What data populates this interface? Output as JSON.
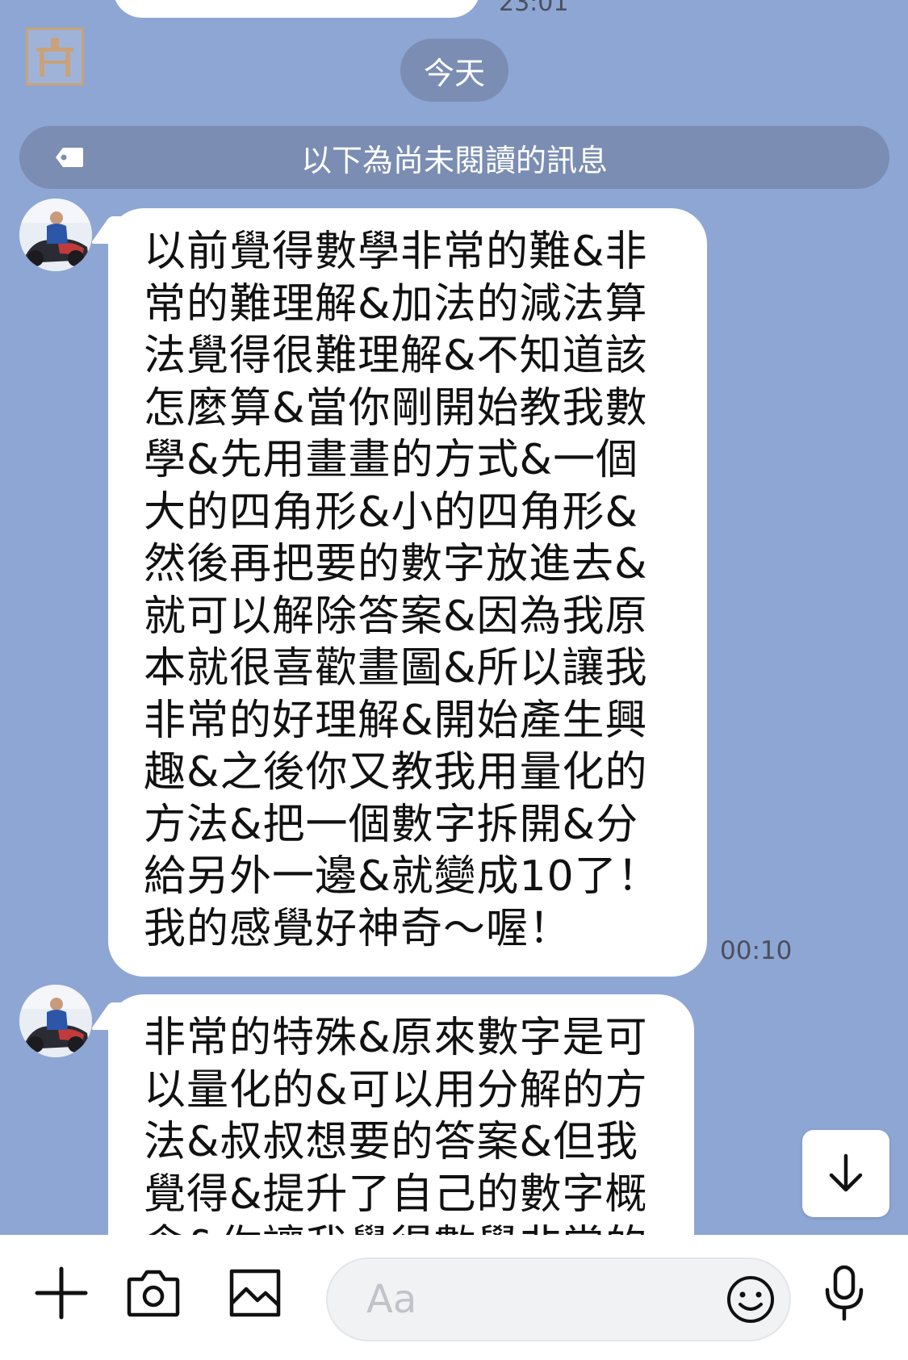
{
  "date_divider": "今天",
  "unread_divider": "以下為尚未閱讀的訊息",
  "messages": [
    {
      "lines": [
        "以前覺得數學非常的難&非",
        "常的難理解&加法的減法算",
        "法覺得很難理解&不知道該",
        "怎麼算&當你剛開始教我數",
        "學&先用畫畫的方式&一個",
        "大的四角形&小的四角形&",
        "然後再把要的數字放進去&",
        "就可以解除答案&因為我原",
        "本就很喜歡畫圖&所以讓我",
        "非常的好理解&開始產生興",
        "趣&之後你又教我用量化的",
        "方法&把一個數字拆開&分",
        "給另外一邊&就變成10了！",
        "我的感覺好神奇～喔！"
      ],
      "time": "00:10"
    },
    {
      "lines": [
        "非常的特殊&原來數字是可",
        "以量化的&可以用分解的方",
        "法&叔叔想要的答案&但我",
        "覺得&提升了自己的數字概",
        "念&你讓我覺得數學非常的"
      ]
    }
  ],
  "composer": {
    "placeholder": "Aa",
    "icons": [
      "plus-icon",
      "camera-icon",
      "image-icon",
      "emoji-icon",
      "microphone-icon"
    ]
  },
  "scroll_icon": "arrow-down-icon",
  "colors": {
    "background": "#8ea6d4",
    "divider": "#7b8db3",
    "bubble": "#ffffff"
  }
}
